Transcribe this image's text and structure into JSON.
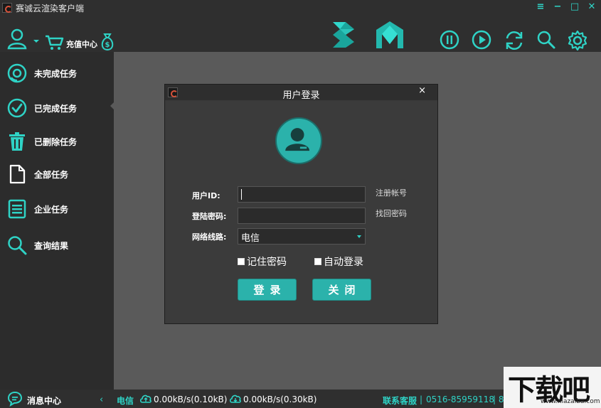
{
  "window": {
    "title": "赛诚云渲染客户端",
    "controls": [
      "menu-icon",
      "minimize-icon",
      "maximize-icon",
      "close-icon"
    ]
  },
  "toolbar": {
    "recharge_label": "充值中心",
    "icons": [
      "user-icon",
      "cart-icon",
      "money-bag-icon",
      "3dsmax-icon",
      "maya-icon",
      "pause-icon",
      "play-icon",
      "refresh-icon",
      "search-icon",
      "settings-icon"
    ],
    "accent": "#2fd3c6"
  },
  "sidebar": {
    "items": [
      {
        "label": "未完成任务",
        "icon": "pending-icon"
      },
      {
        "label": "已完成任务",
        "icon": "check-circle-icon"
      },
      {
        "label": "已删除任务",
        "icon": "trash-icon"
      },
      {
        "label": "全部任务",
        "icon": "document-icon"
      },
      {
        "label": "企业任务",
        "icon": "list-icon"
      },
      {
        "label": "查询结果",
        "icon": "search-icon"
      }
    ],
    "active_index": 1,
    "message_center": "消息中心"
  },
  "status": {
    "isp": "电信",
    "upload": "0.00kB/s(0.10kB)",
    "download": "0.00kB/s(0.30kB)",
    "support_label": "联系客服",
    "separator": "|",
    "phone": "0516-85959118",
    "trailing": "| 8"
  },
  "dialog": {
    "title": "用户登录",
    "close": "×",
    "user_id_label": "用户ID:",
    "user_id_value": "",
    "password_label": "登陆密码:",
    "password_value": "",
    "line_label": "网络线路:",
    "line_value": "电信",
    "register_link": "注册帐号",
    "recover_link": "找回密码",
    "remember_label": "记住密码",
    "autologin_label": "自动登录",
    "login_button": "登录",
    "close_button": "关闭"
  },
  "watermark": {
    "big": "下载吧",
    "small": "www.xiazaiba.com"
  }
}
